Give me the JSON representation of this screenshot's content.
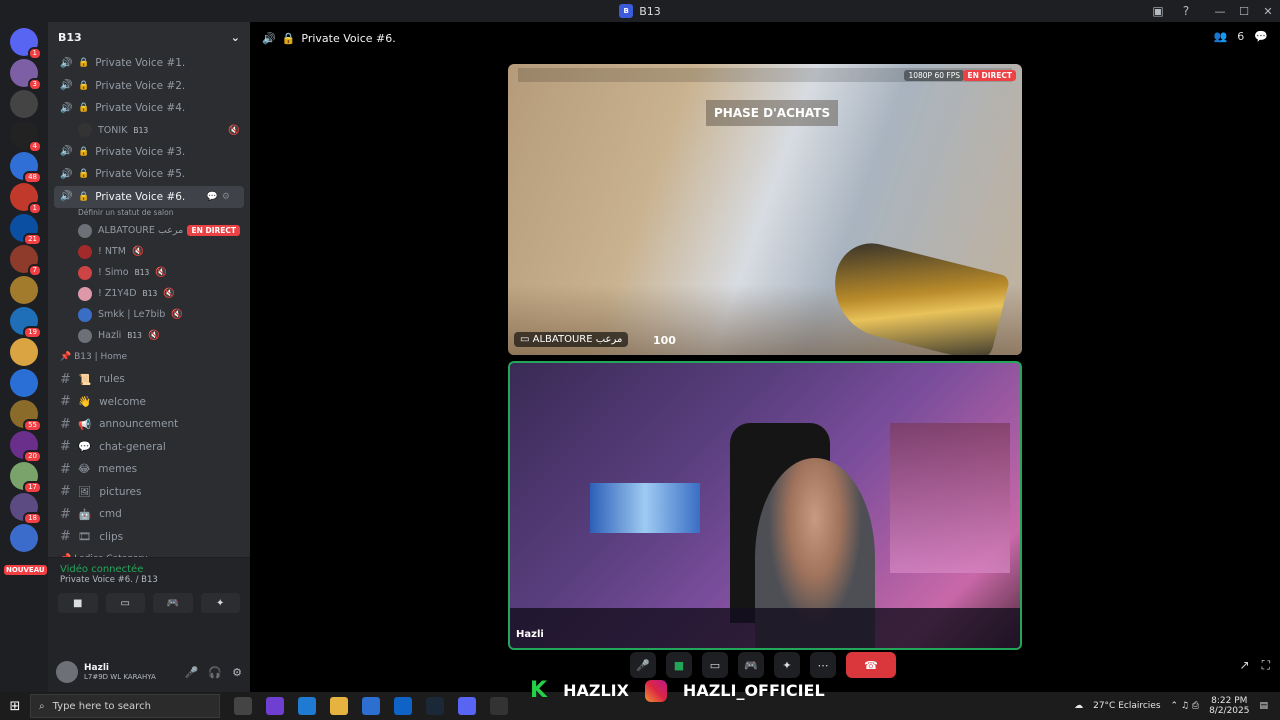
{
  "window": {
    "title": "B13"
  },
  "colors": {
    "accent": "#5865f2",
    "online": "#23a55a",
    "live": "#ed4245"
  },
  "server_rail": {
    "servers": [
      {
        "color": "#5865f2",
        "badge": "1"
      },
      {
        "color": "#7d5fa5",
        "badge": "3"
      },
      {
        "color": "#444",
        "badge": ""
      },
      {
        "color": "#222",
        "badge": "4"
      },
      {
        "color": "#2f6fd6",
        "badge": "48"
      },
      {
        "color": "#c0392b",
        "badge": "1"
      },
      {
        "color": "#0b4fa3",
        "badge": "21"
      },
      {
        "color": "#8e3b2c",
        "badge": "7"
      },
      {
        "color": "#a37b2d",
        "badge": ""
      },
      {
        "color": "#1e6fb8",
        "badge": "19"
      },
      {
        "color": "#d9a441",
        "badge": ""
      },
      {
        "color": "#2a6fd6",
        "badge": ""
      },
      {
        "color": "#8a6b2a",
        "badge": "55"
      },
      {
        "color": "#6a2f8a",
        "badge": "20"
      },
      {
        "color": "#7aa36b",
        "badge": "17"
      },
      {
        "color": "#5c4a82",
        "badge": "18"
      },
      {
        "color": "#3c6ccb",
        "badge": ""
      }
    ],
    "nouveau_label": "NOUVEAU"
  },
  "sidebar": {
    "guild_name": "B13",
    "voice_channels": [
      {
        "name": "Private Voice #1.",
        "active": false
      },
      {
        "name": "Private Voice #2.",
        "active": false
      },
      {
        "name": "Private Voice #4.",
        "active": false
      }
    ],
    "ch4_member": {
      "name": "TONIK",
      "tag": "B13"
    },
    "voice_channels_2": [
      {
        "name": "Private Voice #3."
      },
      {
        "name": "Private Voice #5."
      }
    ],
    "active_channel": {
      "name": "Private Voice #6.",
      "status_prompt": "Définir un statut de salon"
    },
    "members": [
      {
        "name": "ALBATOURE مرعب",
        "live": "EN DIRECT",
        "color": "#6d7177"
      },
      {
        "name": "! NTM",
        "color": "#a32a2a"
      },
      {
        "name": "! Simo",
        "tag": "B13",
        "color": "#c44"
      },
      {
        "name": "! Z1Y4D",
        "tag": "B13",
        "color": "#d9a"
      },
      {
        "name": "Smkk | Le7bib",
        "color": "#3a6ec4"
      },
      {
        "name": "Hazli",
        "tag": "B13",
        "color": "#6d7177"
      }
    ],
    "category": "B13 | Home",
    "text_channels": [
      {
        "icon": "📜",
        "name": "rules"
      },
      {
        "icon": "👋",
        "name": "welcome"
      },
      {
        "icon": "📢",
        "name": "announcement"
      },
      {
        "icon": "💬",
        "name": "chat-general"
      },
      {
        "icon": "😂",
        "name": "memes"
      },
      {
        "icon": "🖼",
        "name": "pictures"
      },
      {
        "icon": "🤖",
        "name": "cmd"
      },
      {
        "icon": "🎞",
        "name": "clips"
      }
    ],
    "next_category": "Ladies-Category"
  },
  "voice_panel": {
    "status": "Vidéo connectée",
    "location": "Private Voice #6. / B13"
  },
  "user_panel": {
    "name": "Hazli",
    "status": "L7#9D WL KARAHYA"
  },
  "stage": {
    "channel_name": "Private Voice #6.",
    "participant_count": "6",
    "tile1": {
      "phase": "PHASE D'ACHATS",
      "quality": "1080P 60 FPS",
      "live": "EN DIRECT",
      "name": "ALBATOURE مرعب",
      "hp": "100"
    },
    "tile2": {
      "name": "Hazli"
    }
  },
  "taskbar": {
    "search_placeholder": "Type here to search",
    "weather": "27°C  Eclaircies",
    "time": "8:22 PM",
    "date": "8/2/2025",
    "overlay_brand1": "HAZLIX",
    "overlay_brand2": "HAZLI_OFFICIEL"
  }
}
